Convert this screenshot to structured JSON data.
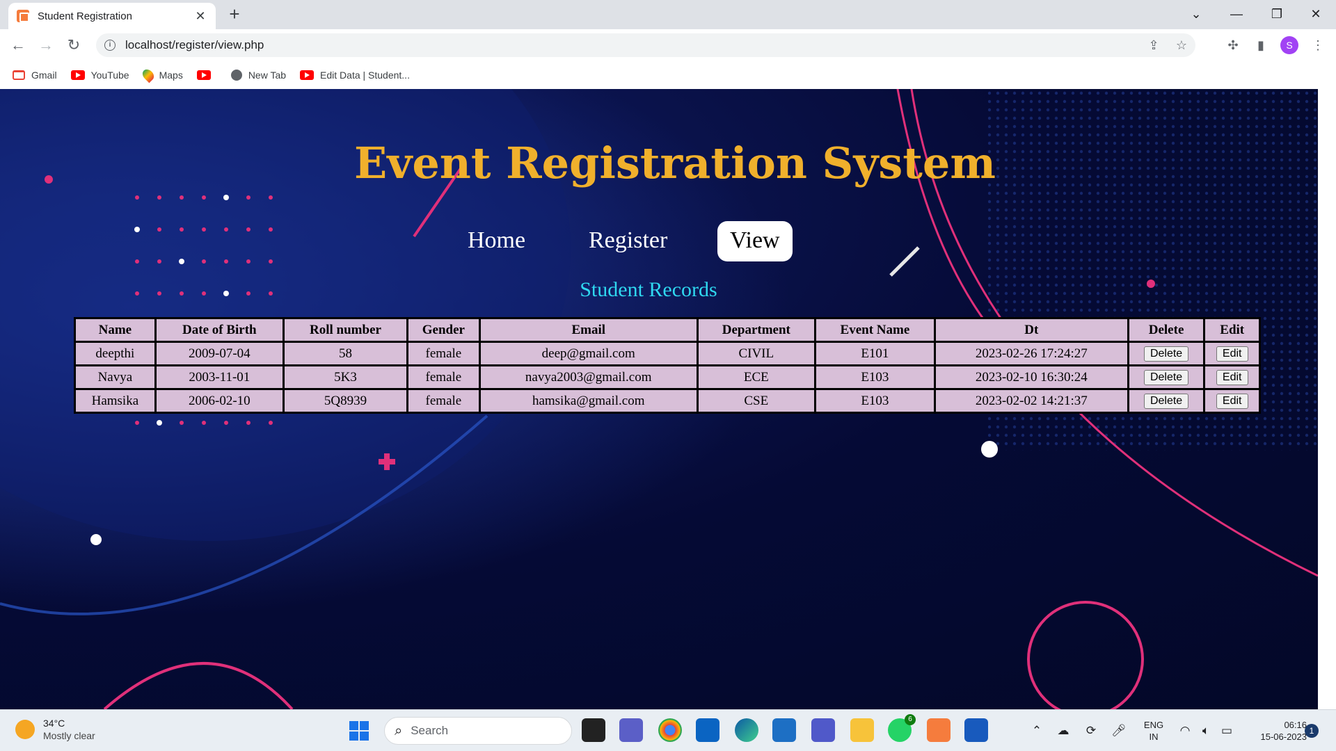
{
  "browser": {
    "tab_title": "Student Registration",
    "url": "localhost/register/view.php",
    "profile_initial": "S",
    "bookmarks": [
      {
        "label": "Gmail",
        "icon": "gmail-icon"
      },
      {
        "label": "YouTube",
        "icon": "youtube-icon"
      },
      {
        "label": "Maps",
        "icon": "maps-icon"
      },
      {
        "label": "",
        "icon": "youtube-icon"
      },
      {
        "label": "New Tab",
        "icon": "globe-icon"
      },
      {
        "label": "Edit Data | Student...",
        "icon": "youtube-icon"
      }
    ]
  },
  "site": {
    "title": "Event Registration System",
    "nav": {
      "home": "Home",
      "register": "Register",
      "view": "View"
    },
    "active_nav": "View",
    "section_title": "Student Records",
    "accent_title_color": "#f0b02c",
    "section_color": "#2fd8f0",
    "table_cell_color": "#d8bfd8"
  },
  "table": {
    "headers": [
      "Name",
      "Date of Birth",
      "Roll number",
      "Gender",
      "Email",
      "Department",
      "Event Name",
      "Dt",
      "Delete",
      "Edit"
    ],
    "rows": [
      {
        "name": "deepthi",
        "dob": "2009-07-04",
        "roll": "58",
        "gender": "female",
        "email": "deep@gmail.com",
        "dept": "CIVIL",
        "event": "E101",
        "dt": "2023-02-26 17:24:27",
        "delete": "Delete",
        "edit": "Edit"
      },
      {
        "name": "Navya",
        "dob": "2003-11-01",
        "roll": "5K3",
        "gender": "female",
        "email": "navya2003@gmail.com",
        "dept": "ECE",
        "event": "E103",
        "dt": "2023-02-10 16:30:24",
        "delete": "Delete",
        "edit": "Edit"
      },
      {
        "name": "Hamsika",
        "dob": "2006-02-10",
        "roll": "5Q8939",
        "gender": "female",
        "email": "hamsika@gmail.com",
        "dept": "CSE",
        "event": "E103",
        "dt": "2023-02-02 14:21:37",
        "delete": "Delete",
        "edit": "Edit"
      }
    ]
  },
  "taskbar": {
    "temperature": "34°C",
    "weather": "Mostly clear",
    "search_placeholder": "Search",
    "whatsapp_badge": "6",
    "lang_top": "ENG",
    "lang_bottom": "IN",
    "time": "06:16",
    "date": "15-06-2023",
    "notification_count": "1"
  }
}
